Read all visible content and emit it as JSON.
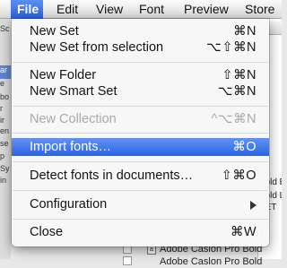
{
  "menubar": {
    "items": [
      {
        "label": "File"
      },
      {
        "label": "Edit"
      },
      {
        "label": "View"
      },
      {
        "label": "Font"
      },
      {
        "label": "Preview"
      },
      {
        "label": "Store"
      }
    ]
  },
  "file_menu": {
    "items": [
      {
        "label": "New Set",
        "shortcut": "⌘N",
        "enabled": true
      },
      {
        "label": "New Set from selection",
        "shortcut": "⌥⇧⌘N",
        "enabled": true
      },
      {
        "label": "New Folder",
        "shortcut": "⇧⌘N",
        "enabled": true
      },
      {
        "label": "New Smart Set",
        "shortcut": "⌥⌘N",
        "enabled": true
      },
      {
        "label": "New Collection",
        "shortcut": "^⌥⌘N",
        "enabled": false
      },
      {
        "label": "Import fonts…",
        "shortcut": "⌘O",
        "enabled": true,
        "highlighted": true
      },
      {
        "label": "Detect fonts in documents…",
        "shortcut": "⇧⌘O",
        "enabled": true
      },
      {
        "label": "Configuration",
        "submenu_icon": "chevron-right-icon",
        "enabled": true
      },
      {
        "label": "Close",
        "shortcut": "⌘W",
        "enabled": true
      }
    ]
  },
  "background": {
    "left_rows": [
      "Sc",
      "ar",
      "e",
      "bo",
      "r",
      "ir",
      "en",
      "se",
      "p",
      "Sy",
      "in"
    ],
    "right_rows": [
      "bold E",
      "bold L",
      "LET",
      "ld"
    ],
    "bottom_rows": [
      "Adobe Caslon Pro Bold",
      "Adobe Caslon Pro Bold"
    ]
  }
}
